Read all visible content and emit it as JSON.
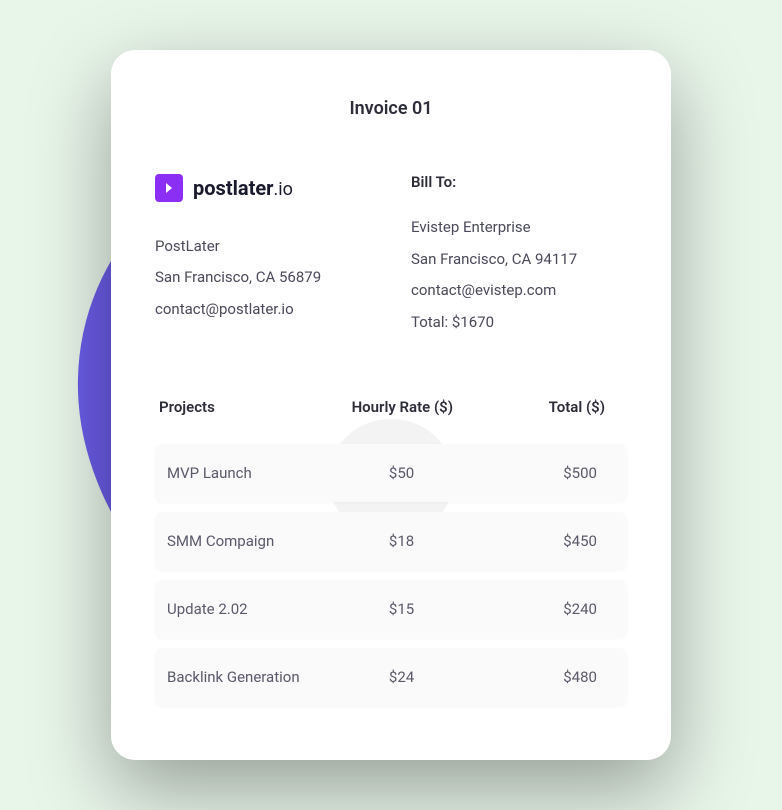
{
  "title": "Invoice 01",
  "brand": {
    "name_bold": "postlater",
    "name_suffix": ".io"
  },
  "from": {
    "name": "PostLater",
    "address": "San Francisco, CA 56879",
    "email": "contact@postlater.io"
  },
  "bill_to": {
    "label": "Bill To:",
    "name": "Evistep Enterprise",
    "address": "San Francisco, CA 94117",
    "email": "contact@evistep.com",
    "total": "Total: $1670"
  },
  "columns": {
    "project": "Projects",
    "rate": "Hourly Rate ($)",
    "total": "Total ($)"
  },
  "rows": [
    {
      "project": "MVP Launch",
      "rate": "$50",
      "total": "$500"
    },
    {
      "project": "SMM Compaign",
      "rate": "$18",
      "total": "$450"
    },
    {
      "project": "Update 2.02",
      "rate": "$15",
      "total": "$240"
    },
    {
      "project": "Backlink Generation",
      "rate": "$24",
      "total": "$480"
    }
  ]
}
